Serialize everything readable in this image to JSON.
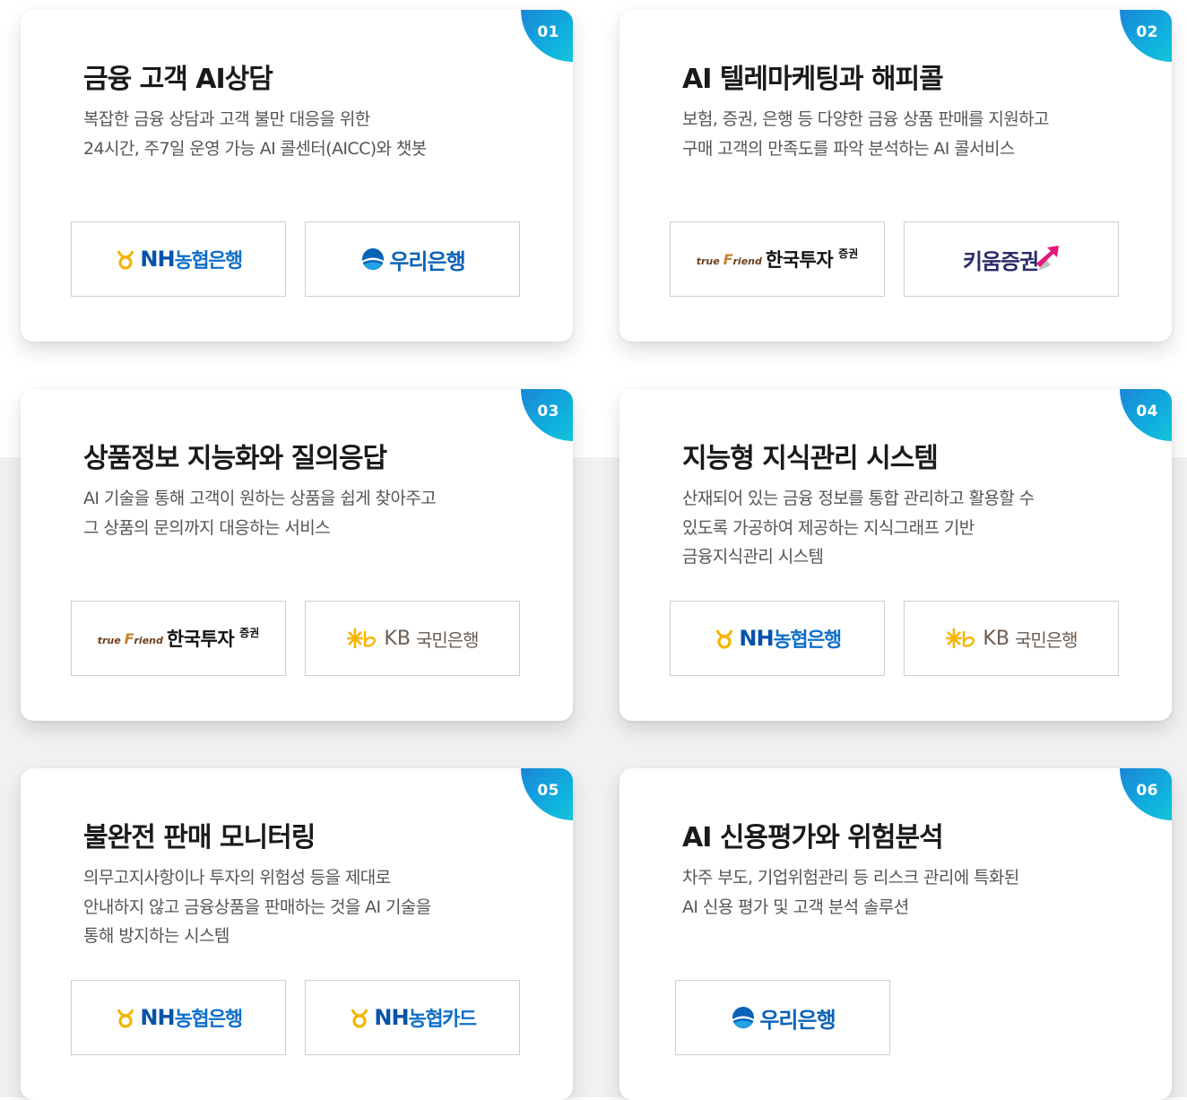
{
  "cards": [
    {
      "number": "01",
      "title": "금융 고객 AI상담",
      "lines": [
        "복잡한 금융 상담과 고객 불만 대응을 위한",
        "24시간, 주7일 운영 가능 AI 콜센터(AICC)와 챗봇"
      ],
      "logos": [
        {
          "icon": "nh-mark-icon",
          "text": "NH",
          "sub": "농협은행"
        },
        {
          "icon": "woori-mark-icon",
          "text": "우리은행"
        }
      ]
    },
    {
      "number": "02",
      "title": "AI 텔레마케팅과 해피콜",
      "lines": [
        "보험, 증권, 은행 등 다양한 금융 상품 판매를 지원하고",
        "구매 고객의 만족도를 파악 분석하는 AI 콜서비스"
      ],
      "logos": [
        {
          "icon": "truefriend-mark-icon",
          "small": "true",
          "f": "F",
          "small2": "riend",
          "text": "한국투자",
          "sub": "증권"
        },
        {
          "icon": "kiwoom-arrow-icon",
          "text": "키움증권"
        }
      ]
    },
    {
      "number": "03",
      "title": "상품정보 지능화와 질의응답",
      "lines": [
        "AI 기술을 통해 고객이 원하는 상품을 쉽게 찾아주고",
        "그 상품의 문의까지 대응하는 서비스"
      ],
      "logos": [
        {
          "icon": "truefriend-mark-icon",
          "small": "true",
          "f": "F",
          "small2": "riend",
          "text": "한국투자",
          "sub": "증권"
        },
        {
          "icon": "kb-star-icon",
          "text": "KB",
          "sub": "국민은행"
        }
      ]
    },
    {
      "number": "04",
      "title": "지능형 지식관리 시스템",
      "lines": [
        "산재되어 있는 금융 정보를 통합 관리하고 활용할 수",
        "있도록 가공하여 제공하는 지식그래프 기반",
        "금융지식관리 시스템"
      ],
      "logos": [
        {
          "icon": "nh-mark-icon",
          "text": "NH",
          "sub": "농협은행"
        },
        {
          "icon": "kb-star-icon",
          "text": "KB",
          "sub": "국민은행"
        }
      ]
    },
    {
      "number": "05",
      "title": "불완전 판매 모니터링",
      "lines": [
        "의무고지사항이나 투자의 위험성 등을 제대로",
        "안내하지 않고 금융상품을 판매하는 것을 AI 기술을",
        "통해 방지하는 시스템"
      ],
      "logos": [
        {
          "icon": "nh-mark-icon",
          "text": "NH",
          "sub": "농협은행"
        },
        {
          "icon": "nh-mark-icon",
          "text": "NH",
          "sub": "농협카드"
        }
      ]
    },
    {
      "number": "06",
      "title": "AI 신용평가와 위험분석",
      "lines": [
        "차주 부도, 기업위험관리 등 리스크 관리에 특화된",
        "AI 신용 평가 및 고객 분석 솔루션"
      ],
      "logos": [
        {
          "icon": "woori-mark-icon",
          "text": "우리은행"
        }
      ]
    }
  ]
}
